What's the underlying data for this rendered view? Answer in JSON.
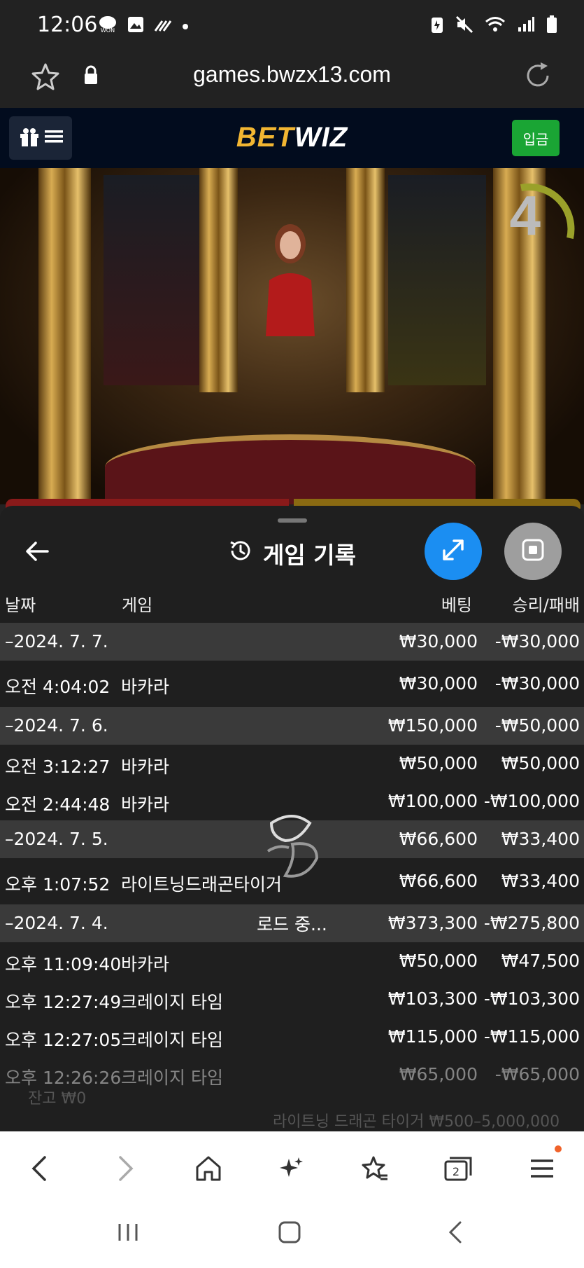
{
  "status": {
    "time": "12:06"
  },
  "browser": {
    "url": "games.bwzx13.com",
    "tabs_count": "2"
  },
  "site": {
    "logo_part1": "BET",
    "logo_part2": "WIZ",
    "deposit_label": "입금"
  },
  "video": {
    "countdown": "4"
  },
  "history": {
    "title": "게임 기록",
    "columns": {
      "date": "날짜",
      "game": "게임",
      "bet": "베팅",
      "result": "승리/패배"
    },
    "rows": [
      {
        "type": "date",
        "date": "–2024. 7. 7.",
        "game": "",
        "bet": "₩30,000",
        "result": "-₩30,000"
      },
      {
        "type": "entry",
        "date": "오전 4:04:02",
        "game": "바카라",
        "bet": "₩30,000",
        "result": "-₩30,000"
      },
      {
        "type": "date",
        "date": "–2024. 7. 6.",
        "game": "",
        "bet": "₩150,000",
        "result": "-₩50,000"
      },
      {
        "type": "entry",
        "date": "오전 3:12:27",
        "game": "바카라",
        "bet": "₩50,000",
        "result": "₩50,000"
      },
      {
        "type": "entry",
        "date": "오전 2:44:48",
        "game": "바카라",
        "bet": "₩100,000",
        "result": "-₩100,000"
      },
      {
        "type": "date",
        "date": "–2024. 7. 5.",
        "game": "",
        "bet": "₩66,600",
        "result": "₩33,400"
      },
      {
        "type": "entry",
        "date": "오후 1:07:52",
        "game": "라이트닝드래곤타이거",
        "bet": "₩66,600",
        "result": "₩33,400"
      },
      {
        "type": "date",
        "date": "–2024. 7. 4.",
        "game": "",
        "bet": "₩373,300",
        "result": "-₩275,800"
      },
      {
        "type": "entry",
        "date": "오후 11:09:40",
        "game": "바카라",
        "bet": "₩50,000",
        "result": "₩47,500"
      },
      {
        "type": "entry",
        "date": "오후 12:27:49",
        "game": "크레이지 타임",
        "bet": "₩103,300",
        "result": "-₩103,300"
      },
      {
        "type": "entry",
        "date": "오후 12:27:05",
        "game": "크레이지 타임",
        "bet": "₩115,000",
        "result": "-₩115,000"
      },
      {
        "type": "entry",
        "date": "오후 12:26:26",
        "game": "크레이지 타임",
        "bet": "₩65,000",
        "result": "-₩65,000"
      }
    ],
    "loading": "로드 중..."
  },
  "background": {
    "balance": "잔고 ₩0",
    "limits": "라이트닝 드래곤 타이거 ₩500–5,000,000"
  }
}
